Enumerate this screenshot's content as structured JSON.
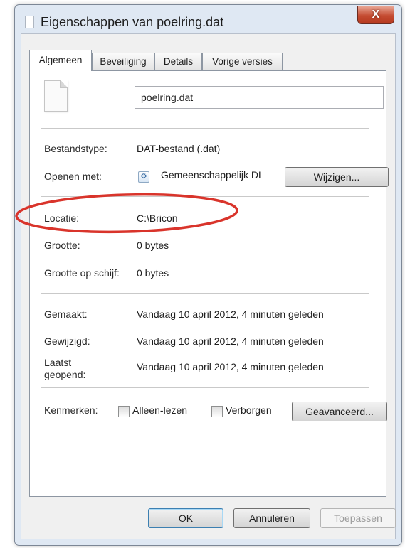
{
  "window": {
    "title": "Eigenschappen van poelring.dat",
    "close_label": "X"
  },
  "tabs": [
    {
      "label": "Algemeen",
      "active": true
    },
    {
      "label": "Beveiliging",
      "active": false
    },
    {
      "label": "Details",
      "active": false
    },
    {
      "label": "Vorige versies",
      "active": false
    }
  ],
  "general": {
    "file_name": "poelring.dat",
    "type_label": "Bestandstype:",
    "type_value": "DAT-bestand (.dat)",
    "opens_with_label": "Openen met:",
    "opens_with_value": "Gemeenschappelijk DL",
    "change_button": "Wijzigen...",
    "location_label": "Locatie:",
    "location_value": "C:\\Bricon",
    "size_label": "Grootte:",
    "size_value": "0 bytes",
    "size_on_disk_label": "Grootte op schijf:",
    "size_on_disk_value": "0 bytes",
    "created_label": "Gemaakt:",
    "created_value": "Vandaag 10 april 2012, 4 minuten geleden",
    "modified_label": "Gewijzigd:",
    "modified_value": "Vandaag 10 april 2012, 4 minuten geleden",
    "accessed_label_line1": "Laatst",
    "accessed_label_line2": "geopend:",
    "accessed_value": "Vandaag 10 april 2012, 4 minuten geleden",
    "attributes_label": "Kenmerken:",
    "readonly_label": "Alleen-lezen",
    "readonly_checked": false,
    "hidden_label": "Verborgen",
    "hidden_checked": false,
    "advanced_button": "Geavanceerd..."
  },
  "footer": {
    "ok": "OK",
    "cancel": "Annuleren",
    "apply": "Toepassen"
  },
  "colors": {
    "highlight_ellipse": "#d9342b",
    "frame": "#dfe8f3",
    "close_button": "#c44b31"
  },
  "icons": {
    "title": "file-icon",
    "large": "file-icon",
    "app": "dll-app-icon"
  }
}
